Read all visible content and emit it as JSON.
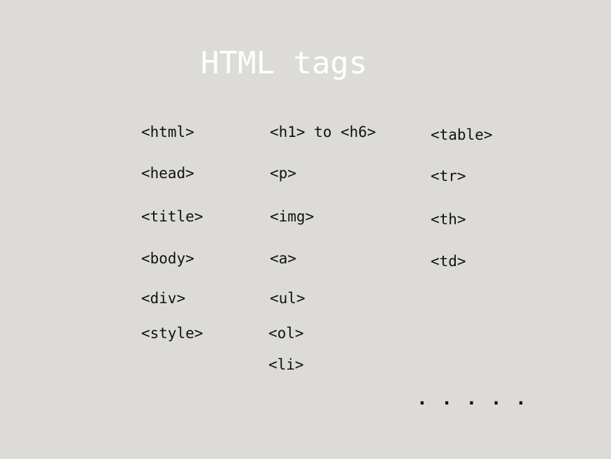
{
  "title": "HTML tags",
  "columns": [
    {
      "items": [
        "<html>",
        "<head>",
        "<title>",
        "<body>",
        "<div>",
        "<style>"
      ]
    },
    {
      "items": [
        "<h1> to <h6>",
        "<p>",
        "<img>",
        "<a>",
        "<ul>",
        "<ol>",
        "<li>"
      ]
    },
    {
      "items": [
        "<table>",
        "<tr>",
        "<th>",
        "<td>"
      ]
    }
  ],
  "ellipsis": ". . . . .",
  "colors": {
    "background": "#dcdbd8",
    "title": "#ffffff",
    "text": "#111111"
  }
}
